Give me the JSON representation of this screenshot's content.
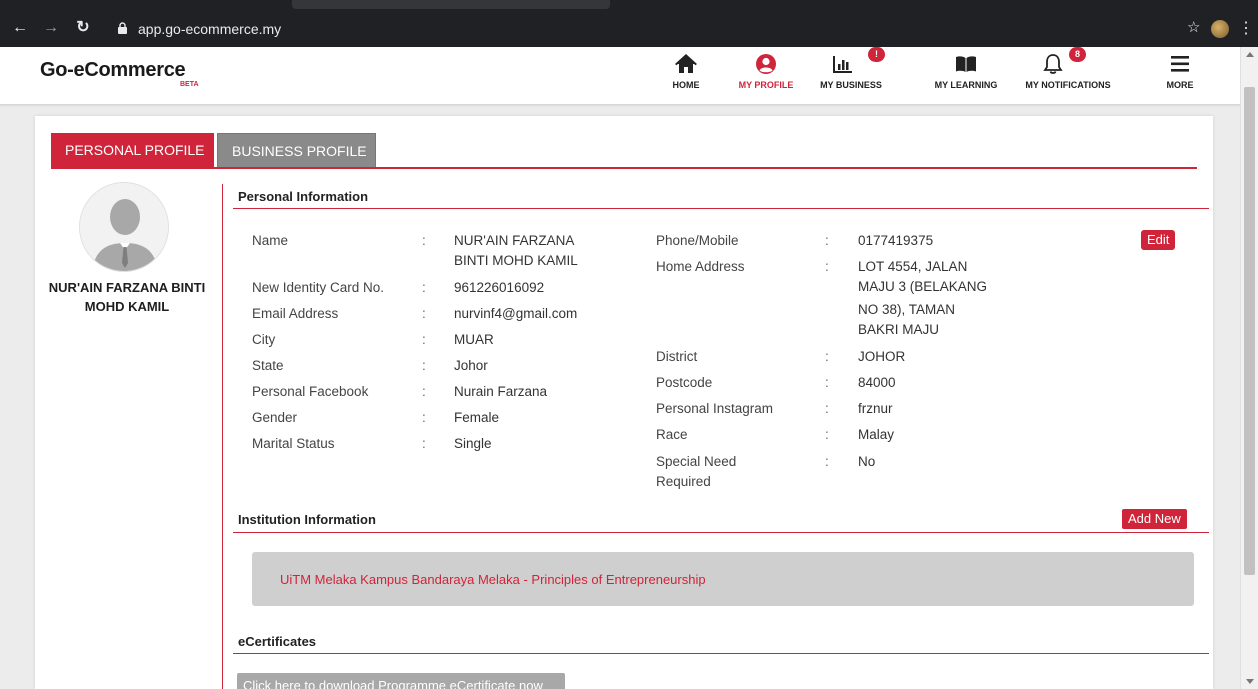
{
  "browser": {
    "url": "app.go-ecommerce.my"
  },
  "app": {
    "logo": "Go-eCommerce",
    "logo_badge": "BETA",
    "accent_color": "#d0243a"
  },
  "nav": {
    "home": "HOME",
    "my_profile": "MY PROFILE",
    "my_business": "MY BUSINESS",
    "my_business_badge": "!",
    "my_learning": "MY LEARNING",
    "my_notifications": "MY NOTIFICATIONS",
    "my_notifications_badge": "8",
    "more": "MORE"
  },
  "tabs": {
    "personal": "PERSONAL PROFILE",
    "business": "BUSINESS PROFILE"
  },
  "profile": {
    "name_line1": "NUR'AIN FARZANA BINTI",
    "name_line2": "MOHD KAMIL"
  },
  "personal_info": {
    "title": "Personal Information",
    "edit_label": "Edit",
    "left": [
      {
        "label": "Name",
        "value": "NUR'AIN FARZANA",
        "value2": "BINTI MOHD KAMIL"
      },
      {
        "label": "New Identity Card No.",
        "value": "961226016092"
      },
      {
        "label": "Email Address",
        "value": "nurvinf4@gmail.com"
      },
      {
        "label": "City",
        "value": "MUAR"
      },
      {
        "label": "State",
        "value": "Johor"
      },
      {
        "label": "Personal Facebook",
        "value": "Nurain Farzana"
      },
      {
        "label": "Gender",
        "value": "Female"
      },
      {
        "label": "Marital Status",
        "value": "Single"
      }
    ],
    "right": [
      {
        "label": "Phone/Mobile",
        "value": "0177419375"
      },
      {
        "label": "Home Address",
        "value": "LOT 4554, JALAN",
        "value2": "MAJU 3 (BELAKANG",
        "value3": "NO 38), TAMAN",
        "value4": "BAKRI MAJU"
      },
      {
        "label": "District",
        "value": "JOHOR"
      },
      {
        "label": "Postcode",
        "value": "84000"
      },
      {
        "label": "Personal Instagram",
        "value": "frznur"
      },
      {
        "label": "Race",
        "value": "Malay"
      },
      {
        "label": "Special Need",
        "label2": "Required",
        "value": "No"
      }
    ]
  },
  "institution": {
    "title": "Institution Information",
    "add_label": "Add New",
    "entry": "UiTM Melaka Kampus Bandaraya Melaka - Principles of Entrepreneurship"
  },
  "certificates": {
    "title": "eCertificates",
    "download_label": "Click here to download Programme eCertificate now"
  }
}
